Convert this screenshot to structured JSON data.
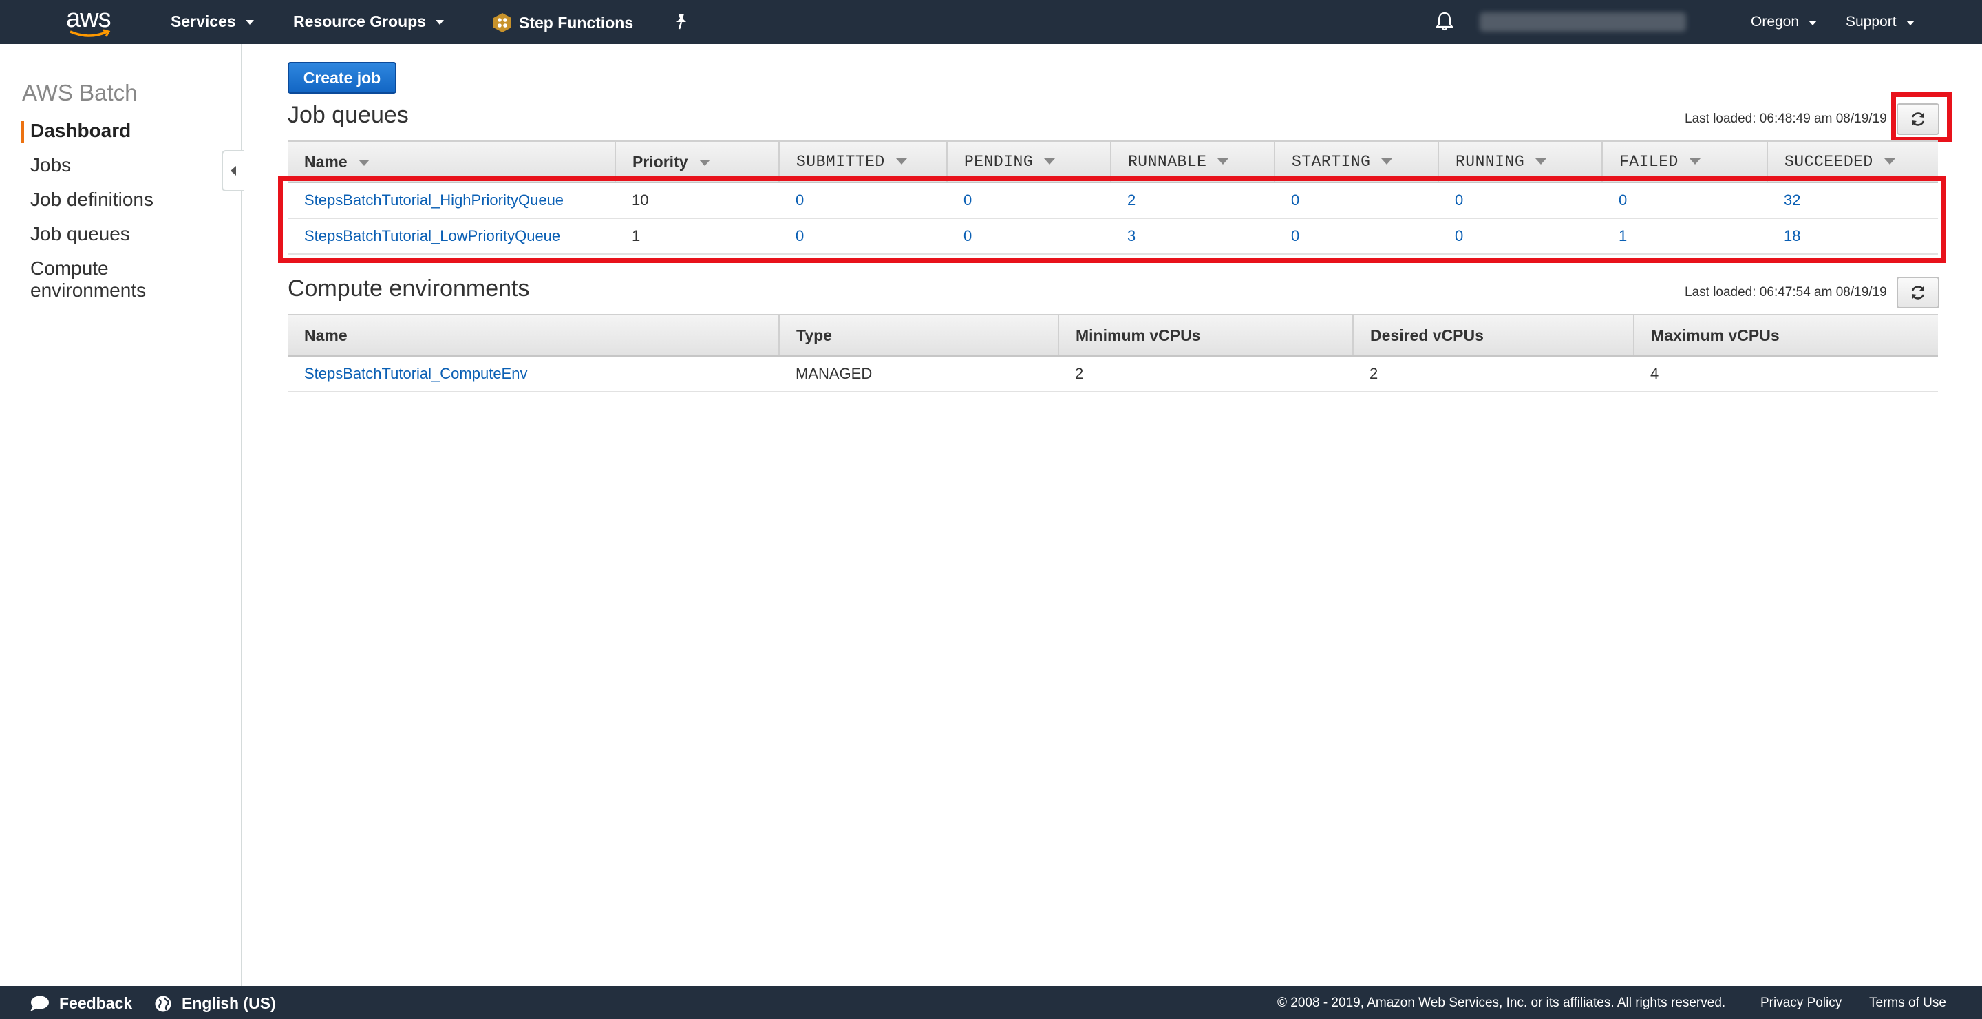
{
  "topnav": {
    "logo": "aws",
    "services": "Services",
    "resource_groups": "Resource Groups",
    "step_functions": "Step Functions",
    "region": "Oregon",
    "support": "Support",
    "icons": {
      "bell": "bell-icon",
      "pin": "pin-icon",
      "step_functions": "step-functions-icon"
    }
  },
  "sidebar": {
    "title": "AWS Batch",
    "items": [
      {
        "label": "Dashboard",
        "active": true
      },
      {
        "label": "Jobs"
      },
      {
        "label": "Job definitions"
      },
      {
        "label": "Job queues"
      },
      {
        "label": "Compute"
      },
      {
        "label": "environments"
      }
    ]
  },
  "main": {
    "create_job": "Create job",
    "job_queues": {
      "title": "Job queues",
      "last_loaded": "Last loaded: 06:48:49 am 08/19/19",
      "columns": [
        "Name",
        "Priority",
        "SUBMITTED",
        "PENDING",
        "RUNNABLE",
        "STARTING",
        "RUNNING",
        "FAILED",
        "SUCCEEDED"
      ],
      "rows": [
        [
          "StepsBatchTutorial_HighPriorityQueue",
          "10",
          "0",
          "0",
          "2",
          "0",
          "0",
          "0",
          "32"
        ],
        [
          "StepsBatchTutorial_LowPriorityQueue",
          "1",
          "0",
          "0",
          "3",
          "0",
          "0",
          "1",
          "18"
        ]
      ]
    },
    "compute_envs": {
      "title": "Compute environments",
      "last_loaded": "Last loaded: 06:47:54 am 08/19/19",
      "columns": [
        "Name",
        "Type",
        "Minimum vCPUs",
        "Desired vCPUs",
        "Maximum vCPUs"
      ],
      "rows": [
        [
          "StepsBatchTutorial_ComputeEnv",
          "MANAGED",
          "2",
          "2",
          "4"
        ]
      ]
    }
  },
  "footer": {
    "feedback": "Feedback",
    "language": "English (US)",
    "copyright": "© 2008 - 2019, Amazon Web Services, Inc. or its affiliates. All rights reserved.",
    "privacy": "Privacy Policy",
    "terms": "Terms of Use"
  },
  "colors": {
    "nav_bg": "#232f3e",
    "link": "#0a5fb4",
    "accent": "#ec7211",
    "highlight": "#e8121b",
    "primary_button": "#1266c4"
  }
}
